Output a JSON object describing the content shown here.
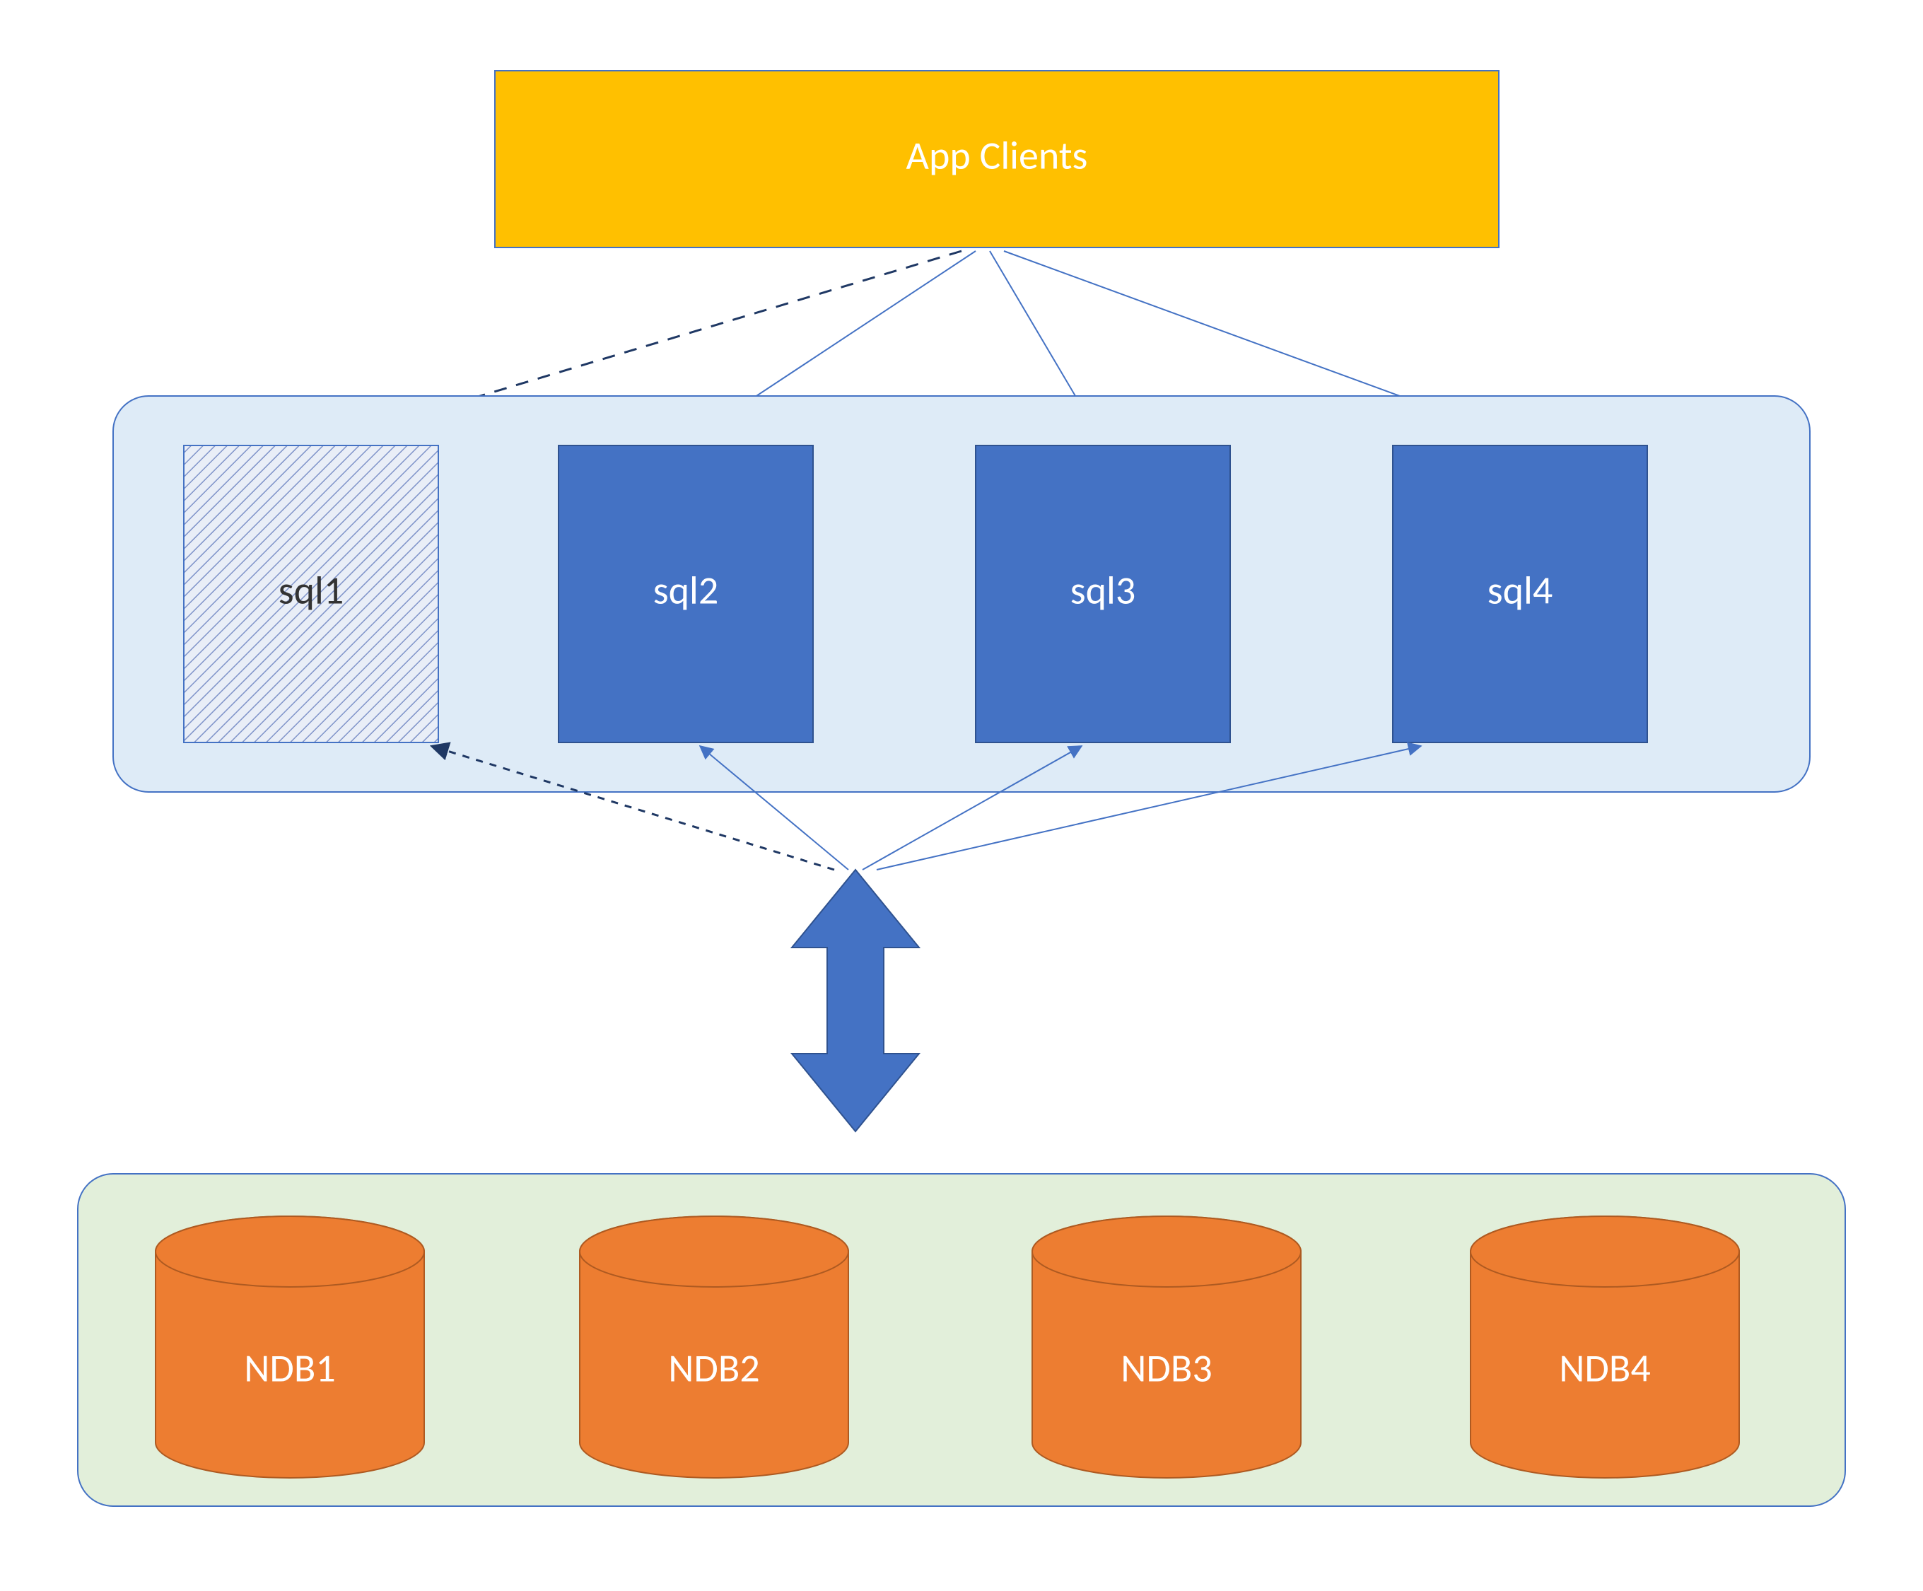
{
  "app_clients": {
    "label": "App Clients"
  },
  "sql_nodes": [
    {
      "label": "sql1",
      "state": "inactive"
    },
    {
      "label": "sql2",
      "state": "active"
    },
    {
      "label": "sql3",
      "state": "active"
    },
    {
      "label": "sql4",
      "state": "active"
    }
  ],
  "ndb_nodes": [
    {
      "label": "NDB1"
    },
    {
      "label": "NDB2"
    },
    {
      "label": "NDB3"
    },
    {
      "label": "NDB4"
    }
  ],
  "colors": {
    "app_fill": "#ffc000",
    "accent_border": "#4472c4",
    "sql_fill": "#4472c4",
    "sql_row_fill": "#deebf7",
    "ndb_fill": "#ed7d31",
    "ndb_row_fill": "#e2efda",
    "dark_line": "#1f3864"
  }
}
